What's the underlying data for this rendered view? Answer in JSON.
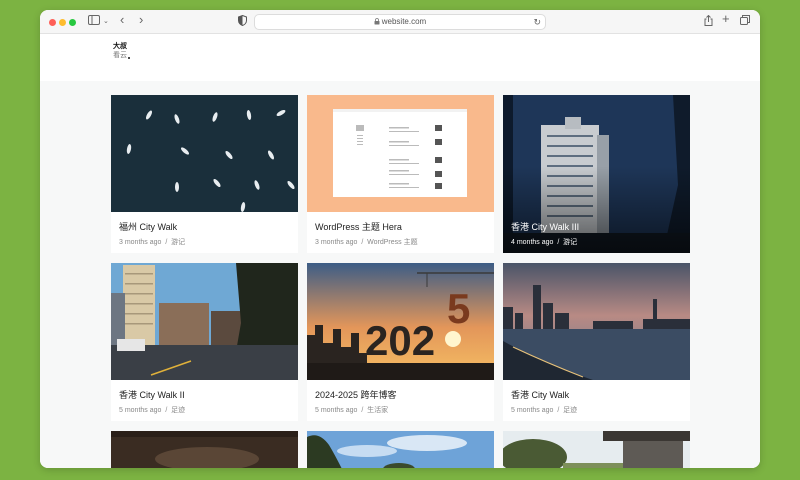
{
  "browser": {
    "url": "website.com"
  },
  "site": {
    "logo_top": "大叔",
    "logo_bottom": "看云"
  },
  "posts": [
    {
      "title": "福州 City Walk",
      "age": "3 months ago",
      "category": "游记"
    },
    {
      "title": "WordPress 主题 Hera",
      "age": "3 months ago",
      "category": "WordPress 主题"
    },
    {
      "title": "香港 City Walk III",
      "age": "4 months ago",
      "category": "游记"
    },
    {
      "title": "香港 City Walk II",
      "age": "5 months ago",
      "category": "足迹"
    },
    {
      "title": "2024-2025 跨年博客",
      "age": "5 months ago",
      "category": "生活家"
    },
    {
      "title": "香港 City Walk",
      "age": "5 months ago",
      "category": "足迹"
    }
  ],
  "meta_separator": "/",
  "thumb_text": {
    "year": "202",
    "digit": "5"
  },
  "colors": {
    "page_bg": "#7cb342",
    "content_bg": "#f7f8f8",
    "wp_thumb_bg": "#f9b98c",
    "boats_water": "#1a2f3b"
  }
}
